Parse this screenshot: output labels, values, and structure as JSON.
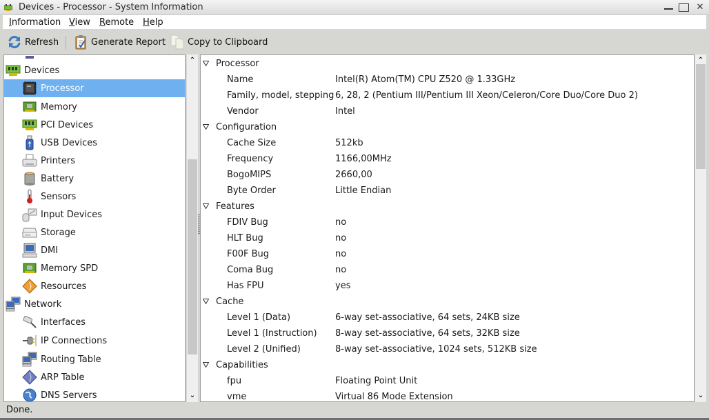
{
  "window": {
    "title": "Devices - Processor - System Information",
    "minimize_icon": "minimize-icon",
    "maximize_icon": "maximize-icon",
    "close_glyph": "✕"
  },
  "menubar": {
    "items": [
      {
        "label": "Information",
        "mnemonic": "I",
        "rest": "nformation"
      },
      {
        "label": "View",
        "mnemonic": "V",
        "rest": "iew"
      },
      {
        "label": "Remote",
        "mnemonic": "R",
        "rest": "emote"
      },
      {
        "label": "Help",
        "mnemonic": "H",
        "rest": "elp"
      }
    ]
  },
  "toolbar": {
    "refresh_label": "Refresh",
    "generate_report_label": "Generate Report",
    "copy_label": "Copy to Clipboard"
  },
  "tree": {
    "items": [
      {
        "label": "Devices",
        "level": 0,
        "icon": "pci-card-icon"
      },
      {
        "label": "Processor",
        "level": 1,
        "icon": "cpu-chip-icon",
        "selected": true
      },
      {
        "label": "Memory",
        "level": 1,
        "icon": "memory-icon"
      },
      {
        "label": "PCI Devices",
        "level": 1,
        "icon": "pci-card-icon"
      },
      {
        "label": "USB Devices",
        "level": 1,
        "icon": "usb-icon"
      },
      {
        "label": "Printers",
        "level": 1,
        "icon": "printer-icon"
      },
      {
        "label": "Battery",
        "level": 1,
        "icon": "battery-icon"
      },
      {
        "label": "Sensors",
        "level": 1,
        "icon": "thermometer-icon"
      },
      {
        "label": "Input Devices",
        "level": 1,
        "icon": "input-devices-icon"
      },
      {
        "label": "Storage",
        "level": 1,
        "icon": "hard-drive-icon"
      },
      {
        "label": "DMI",
        "level": 1,
        "icon": "computer-icon"
      },
      {
        "label": "Memory SPD",
        "level": 1,
        "icon": "memory-icon"
      },
      {
        "label": "Resources",
        "level": 1,
        "icon": "resources-icon"
      },
      {
        "label": "Network",
        "level": 0,
        "icon": "network-icon"
      },
      {
        "label": "Interfaces",
        "level": 1,
        "icon": "network-interface-icon"
      },
      {
        "label": "IP Connections",
        "level": 1,
        "icon": "plug-icon"
      },
      {
        "label": "Routing Table",
        "level": 1,
        "icon": "network-icon"
      },
      {
        "label": "ARP Table",
        "level": 1,
        "icon": "arp-table-icon"
      },
      {
        "label": "DNS Servers",
        "level": 1,
        "icon": "globe-icon"
      }
    ]
  },
  "details": {
    "sections": [
      {
        "title": "Processor",
        "fields": [
          {
            "label": "Name",
            "value": "Intel(R) Atom(TM) CPU Z520   @ 1.33GHz"
          },
          {
            "label": "Family, model, stepping",
            "value": "6, 28, 2 (Pentium III/Pentium III Xeon/Celeron/Core Duo/Core Duo 2)"
          },
          {
            "label": "Vendor",
            "value": "Intel"
          }
        ]
      },
      {
        "title": "Configuration",
        "fields": [
          {
            "label": "Cache Size",
            "value": "512kb"
          },
          {
            "label": "Frequency",
            "value": "1166,00MHz"
          },
          {
            "label": "BogoMIPS",
            "value": "2660,00"
          },
          {
            "label": "Byte Order",
            "value": "Little Endian"
          }
        ]
      },
      {
        "title": "Features",
        "fields": [
          {
            "label": "FDIV Bug",
            "value": "no"
          },
          {
            "label": "HLT Bug",
            "value": "no"
          },
          {
            "label": "F00F Bug",
            "value": "no"
          },
          {
            "label": "Coma Bug",
            "value": "no"
          },
          {
            "label": "Has FPU",
            "value": "yes"
          }
        ]
      },
      {
        "title": "Cache",
        "fields": [
          {
            "label": "Level 1 (Data)",
            "value": "6-way set-associative, 64 sets, 24KB size"
          },
          {
            "label": "Level 1 (Instruction)",
            "value": "8-way set-associative, 64 sets, 32KB size"
          },
          {
            "label": "Level 2 (Unified)",
            "value": "8-way set-associative, 1024 sets, 512KB size"
          }
        ]
      },
      {
        "title": "Capabilities",
        "fields": [
          {
            "label": "fpu",
            "value": "Floating Point Unit"
          },
          {
            "label": "vme",
            "value": "Virtual 86 Mode Extension"
          }
        ]
      }
    ]
  },
  "scrollbars": {
    "up_glyph": "⌃",
    "down_glyph": "⌄"
  },
  "status": {
    "text": "Done."
  }
}
